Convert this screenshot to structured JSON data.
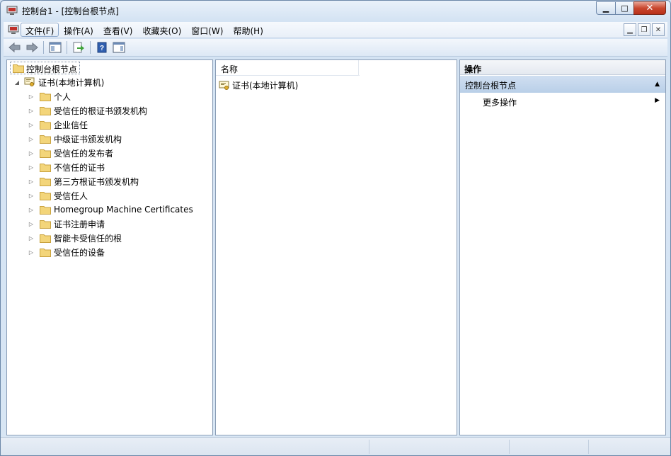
{
  "window": {
    "title": "控制台1 - [控制台根节点]",
    "icon": "mmc-console-icon",
    "caption_buttons": [
      "minimize",
      "maximize",
      "close"
    ]
  },
  "menubar": {
    "items": [
      {
        "label": "文件(F)",
        "active": true
      },
      {
        "label": "操作(A)",
        "active": false
      },
      {
        "label": "查看(V)",
        "active": false
      },
      {
        "label": "收藏夹(O)",
        "active": false
      },
      {
        "label": "窗口(W)",
        "active": false
      },
      {
        "label": "帮助(H)",
        "active": false
      }
    ]
  },
  "toolbar": {
    "buttons": [
      "back-arrow-icon",
      "forward-arrow-icon",
      "show-hide-console-tree-icon",
      "export-list-icon",
      "help-icon",
      "show-hide-action-pane-icon"
    ]
  },
  "tree": {
    "root": "控制台根节点",
    "node": "证书(本地计算机)",
    "children": [
      "个人",
      "受信任的根证书颁发机构",
      "企业信任",
      "中级证书颁发机构",
      "受信任的发布者",
      "不信任的证书",
      "第三方根证书颁发机构",
      "受信任人",
      "Homegroup Machine Certificates",
      "证书注册申请",
      "智能卡受信任的根",
      "受信任的设备"
    ]
  },
  "list": {
    "column_name": "名称",
    "items": [
      "证书(本地计算机)"
    ]
  },
  "actions": {
    "header": "操作",
    "section": "控制台根节点",
    "more": "更多操作"
  },
  "colors": {
    "accent": "#b9cfe8",
    "window_frame": "#d4e3f3",
    "folder": "#f3d57a"
  }
}
